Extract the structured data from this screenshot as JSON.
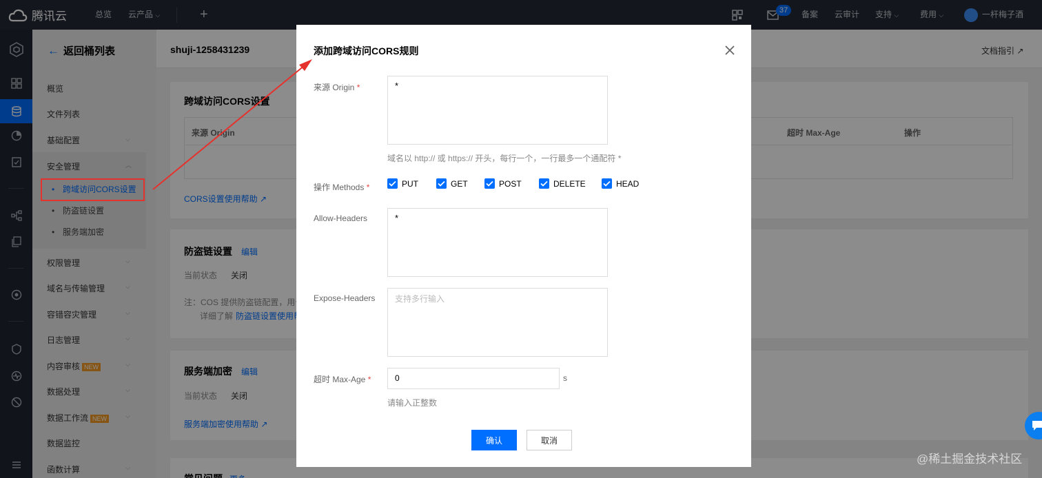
{
  "topbar": {
    "brand": "腾讯云",
    "overview": "总览",
    "products": "云产品",
    "plus": "+",
    "notify_count": "37",
    "beian": "备案",
    "audit": "云审计",
    "support": "支持",
    "billing": "费用",
    "user": "一杆梅子酒"
  },
  "sidebar": {
    "back": "返回桶列表",
    "items": {
      "overview": "概览",
      "files": "文件列表",
      "basic": "基础配置",
      "security": "安全管理",
      "cors": "跨域访问CORS设置",
      "hotlink": "防盗链设置",
      "encrypt": "服务端加密",
      "perm": "权限管理",
      "domain": "域名与传输管理",
      "dr": "容错容灾管理",
      "log": "日志管理",
      "audit": "内容审核",
      "process": "数据处理",
      "workflow": "数据工作流",
      "monitor": "数据监控",
      "func": "函数计算"
    },
    "new_badge": "NEW"
  },
  "main": {
    "bucket": "shuji-1258431239",
    "doc_guide": "文档指引",
    "cors_card": {
      "title": "跨域访问CORS设置",
      "col_origin": "来源 Origin",
      "col_maxage": "超时 Max-Age",
      "col_ops": "操作",
      "help": "CORS设置使用帮助"
    },
    "hotlink_card": {
      "title": "防盗链设置",
      "edit": "编辑",
      "status_label": "当前状态",
      "status_value": "关闭",
      "note": "注：COS 提供防盗链配置，用于",
      "more_prefix": "详细了解",
      "more_link": "防盗链设置使用帮"
    },
    "encrypt_card": {
      "title": "服务端加密",
      "edit": "编辑",
      "status_label": "当前状态",
      "status_value": "关闭",
      "help": "服务端加密使用帮助"
    },
    "faq_card": {
      "title": "常见问题",
      "more": "更多"
    }
  },
  "modal": {
    "title": "添加跨域访问CORS规则",
    "origin_label": "来源 Origin",
    "origin_value": "*",
    "origin_hint": "域名以 http:// 或 https:// 开头，每行一个，一行最多一个通配符 *",
    "methods_label": "操作 Methods",
    "methods": [
      "PUT",
      "GET",
      "POST",
      "DELETE",
      "HEAD"
    ],
    "allow_headers_label": "Allow-Headers",
    "allow_headers_value": "*",
    "expose_headers_label": "Expose-Headers",
    "expose_headers_placeholder": "支持多行输入",
    "maxage_label": "超时 Max-Age",
    "maxage_value": "0",
    "maxage_unit": "s",
    "maxage_hint": "请输入正整数",
    "confirm": "确认",
    "cancel": "取消"
  },
  "watermark": "@稀土掘金技术社区",
  "colors": {
    "accent": "#006eff",
    "annotation": "#e5322d",
    "topbar": "#242b36"
  }
}
